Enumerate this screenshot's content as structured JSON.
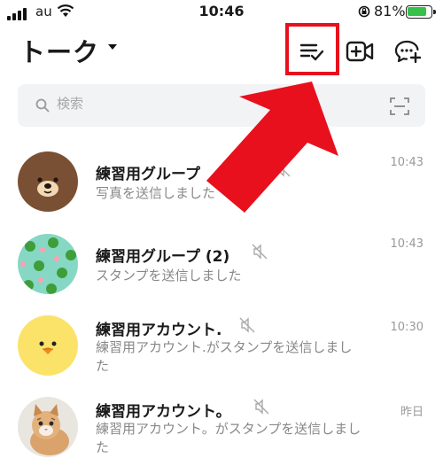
{
  "status_bar": {
    "carrier": "au",
    "time": "10:46",
    "battery_percent": "81%",
    "battery_level": 0.81
  },
  "header": {
    "title": "トーク",
    "icons": [
      "edit-chat-list-icon",
      "video-call-icon",
      "new-chat-icon"
    ]
  },
  "search": {
    "placeholder": "検索"
  },
  "colors": {
    "highlight": "#e8101c",
    "arrow": "#e8101c",
    "muted_text": "#888888",
    "search_bg": "#f2f3f5"
  },
  "chats": [
    {
      "name": "練習用グループ",
      "message": "写真を送信しました",
      "time": "10:43",
      "muted": true,
      "avatar": "brown-bear-avatar"
    },
    {
      "name": "練習用グループ (2)",
      "message": "スタンプを送信しました",
      "time": "10:43",
      "muted": true,
      "avatar": "frog-pattern-avatar"
    },
    {
      "name": "練習用アカウント.",
      "message": "練習用アカウント.がスタンプを送信しました",
      "time": "10:30",
      "muted": true,
      "avatar": "yellow-chick-avatar"
    },
    {
      "name": "練習用アカウント。",
      "message": "練習用アカウント。がスタンプを送信しました",
      "time": "昨日",
      "muted": true,
      "avatar": "kitten-photo-avatar"
    }
  ]
}
